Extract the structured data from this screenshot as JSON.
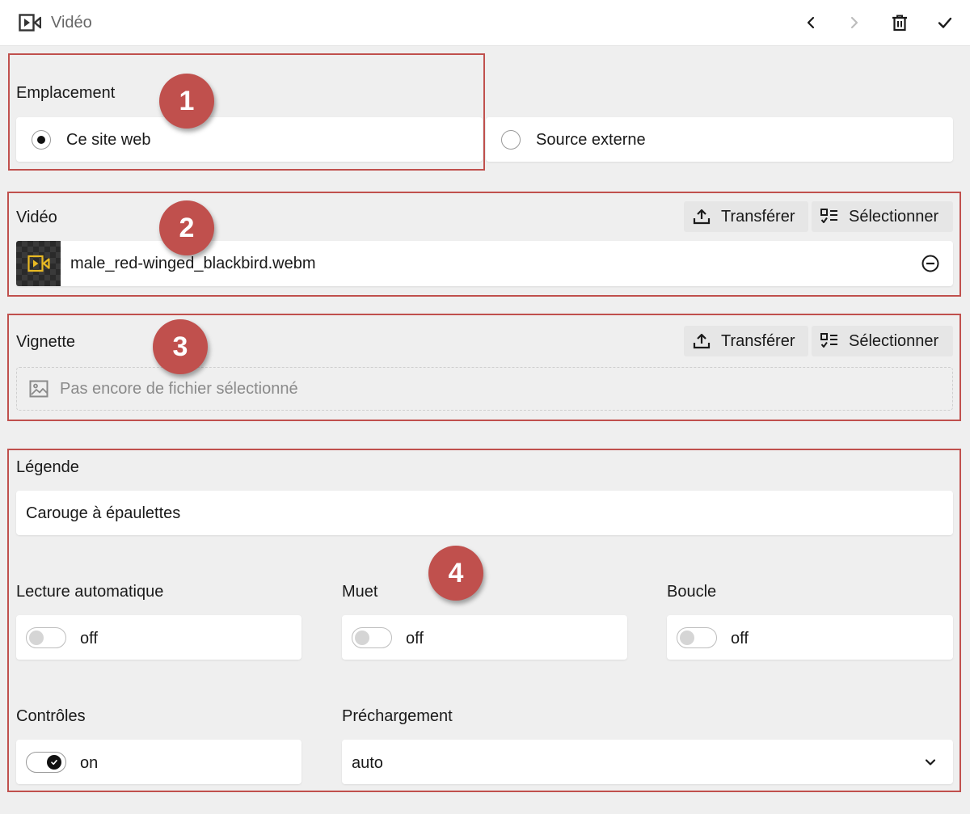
{
  "header": {
    "title": "Vidéo",
    "icons": [
      "video-icon",
      "chevron-left-icon",
      "chevron-right-icon",
      "trash-icon",
      "check-icon"
    ]
  },
  "location": {
    "label": "Emplacement",
    "options": [
      {
        "label": "Ce site web",
        "selected": true
      },
      {
        "label": "Source externe",
        "selected": false
      }
    ]
  },
  "video": {
    "label": "Vidéo",
    "upload_label": "Transférer",
    "select_label": "Sélectionner",
    "filename": "male_red-winged_blackbird.webm"
  },
  "thumbnail": {
    "label": "Vignette",
    "upload_label": "Transférer",
    "select_label": "Sélectionner",
    "empty_text": "Pas encore de fichier sélectionné"
  },
  "caption": {
    "label": "Légende",
    "value": "Carouge à épaulettes"
  },
  "options": {
    "autoplay": {
      "label": "Lecture automatique",
      "state": "off"
    },
    "muted": {
      "label": "Muet",
      "state": "off"
    },
    "loop": {
      "label": "Boucle",
      "state": "off"
    },
    "controls": {
      "label": "Contrôles",
      "state": "on"
    },
    "preload": {
      "label": "Préchargement",
      "value": "auto"
    }
  },
  "annotations": [
    "1",
    "2",
    "3",
    "4"
  ],
  "colors": {
    "annotation": "#c0504d",
    "background": "#efefef",
    "card": "#ffffff",
    "button": "#e6e6e6",
    "thumb_icon": "#e8b923"
  }
}
